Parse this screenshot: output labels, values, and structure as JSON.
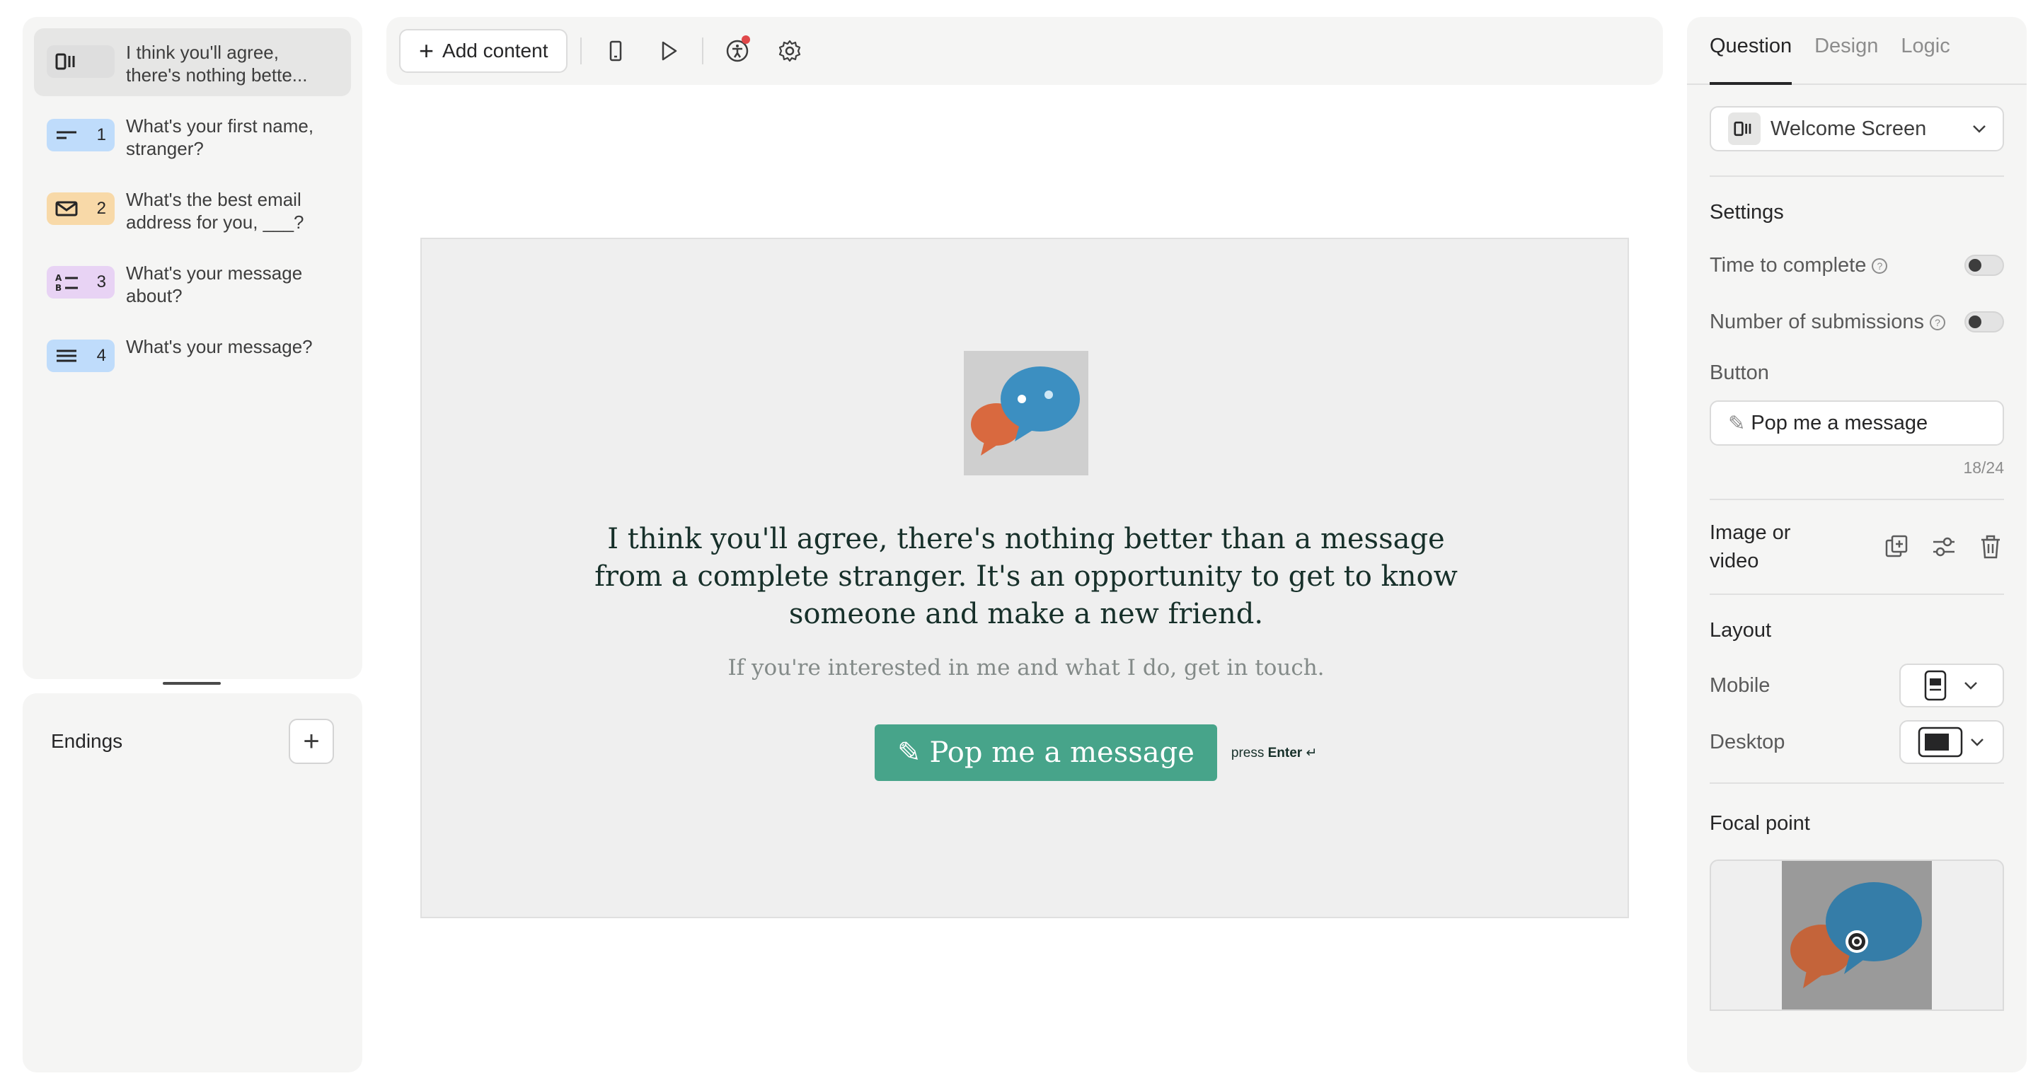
{
  "sidebar": {
    "questions": [
      {
        "number": "",
        "label": "I think you'll agree, there's nothing bette...",
        "color": "#e6e6e5",
        "icon": "welcome-screen-icon"
      },
      {
        "number": "1",
        "label": "What's your first name, stranger?",
        "color": "#bfdcfb",
        "icon": "short-text-icon"
      },
      {
        "number": "2",
        "label": "What's the best email address for you, ___?",
        "color": "#f8d9a8",
        "icon": "email-icon"
      },
      {
        "number": "3",
        "label": "What's your message about?",
        "color": "#e8d3f4",
        "icon": "multiple-choice-icon"
      },
      {
        "number": "4",
        "label": "What's your message?",
        "color": "#bfdcfb",
        "icon": "long-text-icon"
      }
    ],
    "endings_title": "Endings"
  },
  "toolbar": {
    "add_content_label": "Add content"
  },
  "preview": {
    "title": "I think you'll agree, there's nothing better than a message from a complete stranger. It's an opportunity to get to know someone and make a new friend.",
    "description": "If you're interested in me and what I do, get in touch.",
    "button_label": "Pop me a message",
    "button_icon": "✎",
    "hint_prefix": "press",
    "hint_key": "Enter",
    "hint_symbol": "↵",
    "button_color": "#47a48a"
  },
  "right_panel": {
    "tabs": [
      "Question",
      "Design",
      "Logic"
    ],
    "question_type": "Welcome Screen",
    "settings_title": "Settings",
    "time_to_complete": "Time to complete",
    "number_of_submissions": "Number of submissions",
    "button_label_title": "Button",
    "button_value": "Pop me a message",
    "button_value_icon": "✎",
    "counter": "18/24",
    "image_or_video": "Image or video",
    "layout_title": "Layout",
    "mobile_label": "Mobile",
    "desktop_label": "Desktop",
    "focal_point_title": "Focal point"
  }
}
